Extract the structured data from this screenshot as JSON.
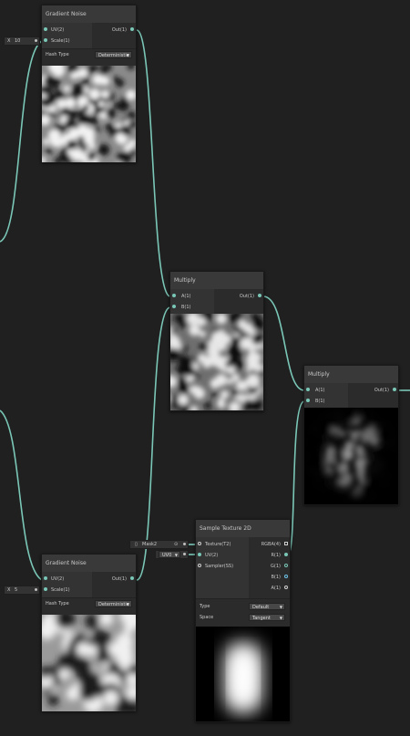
{
  "nodes": {
    "noise1": {
      "title": "Gradient Noise",
      "inputs": [
        "UV(2)",
        "Scale(1)"
      ],
      "output": "Out(1)",
      "hash_label": "Hash Type",
      "hash_value": "Deterministic",
      "scale_field": {
        "axis": "X",
        "value": "10"
      }
    },
    "noise2": {
      "title": "Gradient Noise",
      "inputs": [
        "UV(2)",
        "Scale(1)"
      ],
      "output": "Out(1)",
      "hash_label": "Hash Type",
      "hash_value": "Deterministic",
      "scale_field": {
        "axis": "X",
        "value": "5"
      }
    },
    "mult1": {
      "title": "Multiply",
      "inputs": [
        "A(1)",
        "B(1)"
      ],
      "output": "Out(1)"
    },
    "mult2": {
      "title": "Multiply",
      "inputs": [
        "A(1)",
        "B(1)"
      ],
      "output": "Out(1)"
    },
    "sampler": {
      "title": "Sample Texture 2D",
      "inputs": [
        "Texture(T2)",
        "UV(2)",
        "Sampler(SS)"
      ],
      "outputs": [
        "RGBA(4)",
        "R(1)",
        "G(1)",
        "B(1)",
        "A(1)"
      ],
      "type_label": "Type",
      "type_value": "Default",
      "space_label": "Space",
      "space_value": "Tangent",
      "texture_field": "Mask2",
      "uv_field": "UV0"
    }
  },
  "colors": {
    "background": "#202020",
    "wire": "#7ac7b7",
    "node_body": "#2b2b2b",
    "node_header": "#393939"
  }
}
